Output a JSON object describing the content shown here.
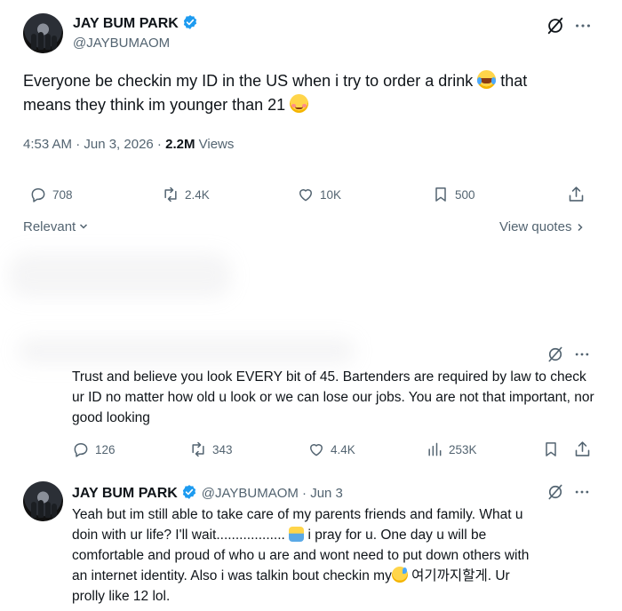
{
  "main_tweet": {
    "name": "JAY BUM PARK",
    "handle": "@JAYBUMAOM",
    "text_part1": "Everyone be checkin my ID in the US when i try to order a drink",
    "text_part2": "that",
    "text_line2": "means they think im younger than 21",
    "timestamp": "4:53 AM · Jun 3, 2026 ·",
    "views_count": "2.2M",
    "views_label": "Views",
    "replies": "708",
    "retweets": "2.4K",
    "likes": "10K",
    "bookmarks": "500"
  },
  "filters": {
    "sort_label": "Relevant",
    "view_quotes": "View quotes"
  },
  "reply1": {
    "text": "Trust and believe you look EVERY bit of 45. Bartenders are required by law to check ur ID no matter how old u look or we can lose our jobs. You are not that important, nor good looking",
    "replies": "126",
    "retweets": "343",
    "likes": "4.4K",
    "views": "253K"
  },
  "reply2": {
    "name": "JAY BUM PARK",
    "handle_date": "@JAYBUMAOM · Jun 3",
    "line1": "Yeah but im still able to take care of my parents friends and family. What u",
    "line2a": "doin with ur life? I'll wait..................",
    "line2b": "i pray for u. One day u will be",
    "line3": "comfortable and proud of who u are and wont need to put down others with",
    "line4a": "an internet identity. Also i was talkin bout checkin my",
    "line4b": "여기까지할게. Ur",
    "line5": "prolly like 12 lol."
  },
  "colors": {
    "verified": "#1d9bf0",
    "text": "#0f1419",
    "secondary": "#536471"
  }
}
